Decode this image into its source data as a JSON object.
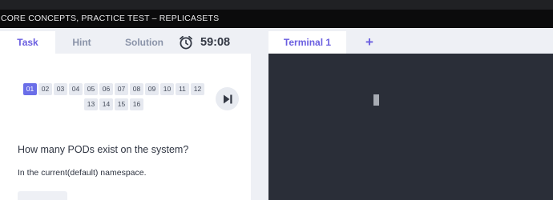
{
  "window": {
    "title": "CORE CONCEPTS, PRACTICE TEST – REPLICASETS"
  },
  "left_panel": {
    "tabs": [
      {
        "label": "Task",
        "active": true
      },
      {
        "label": "Hint",
        "active": false
      },
      {
        "label": "Solution",
        "active": false
      }
    ],
    "timer": {
      "icon": "alarm-clock-icon",
      "value": "59:08"
    },
    "questions": {
      "row1": [
        "01",
        "02",
        "03",
        "04",
        "05",
        "06",
        "07",
        "08",
        "09",
        "10",
        "11",
        "12"
      ],
      "row2": [
        "13",
        "14",
        "15",
        "16"
      ],
      "current": "01"
    },
    "next_icon": "skip-next-icon",
    "question_text": "How many PODs exist on the system?",
    "note_text": "In the current(default) namespace."
  },
  "right_panel": {
    "terminal_tab": {
      "label": "Terminal 1"
    },
    "add_tab": {
      "label": "+"
    }
  },
  "colors": {
    "accent": "#6a5ee0",
    "active_badge": "#6a6ee8",
    "terminal_bg": "#2a2e38",
    "titlebar_bg": "#0b0b0c"
  }
}
